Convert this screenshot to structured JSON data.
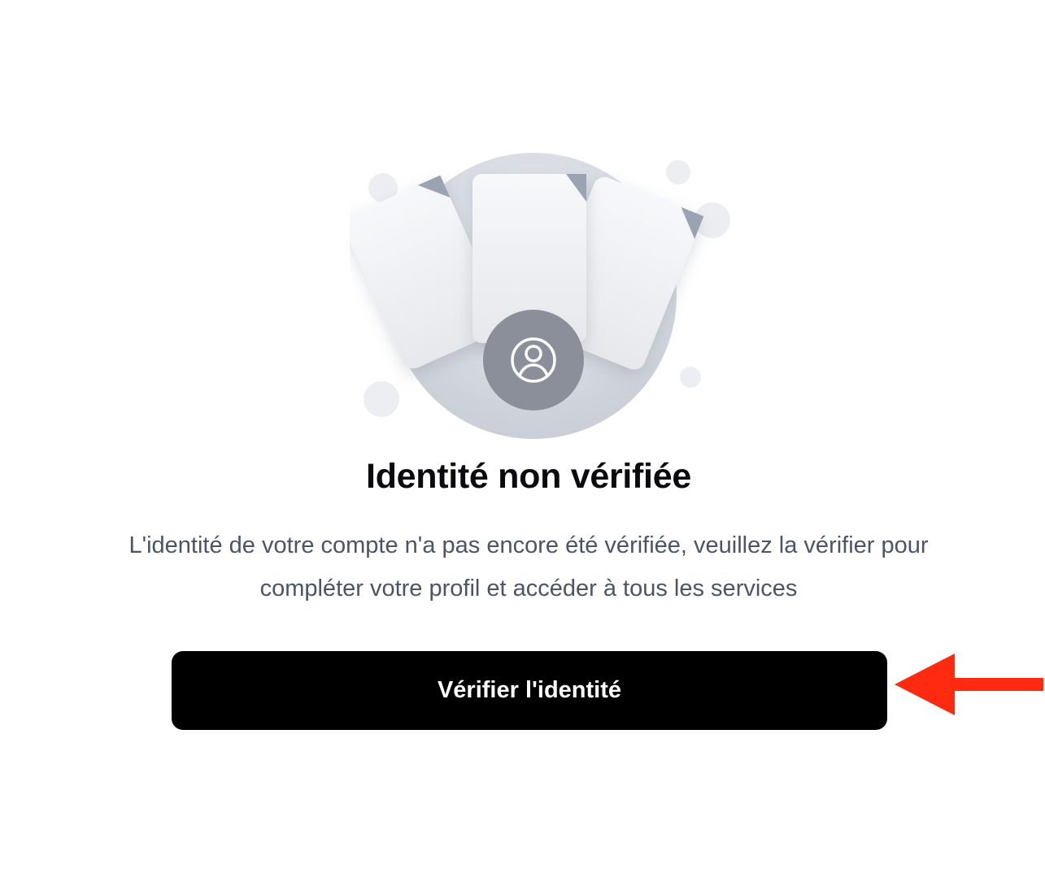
{
  "status": {
    "title": "Identité non vérifiée",
    "description_line1": "L'identité de votre compte n'a pas encore été vérifiée, veuillez la vérifier pour",
    "description_line2": "compléter votre profil et accéder à tous les services"
  },
  "actions": {
    "verify_label": "Vérifier l'identité"
  },
  "icons": {
    "documents": "id-documents-illustration-icon",
    "user": "user-circle-icon",
    "annotation": "red-arrow-icon"
  },
  "colors": {
    "button_bg": "#000000",
    "button_text": "#ffffff",
    "title": "#0b0b0f",
    "description": "#4b5567",
    "annotation_arrow": "#ff2a0f",
    "illustration_circle": "#cfd4dd",
    "user_badge": "#8a8f99"
  }
}
